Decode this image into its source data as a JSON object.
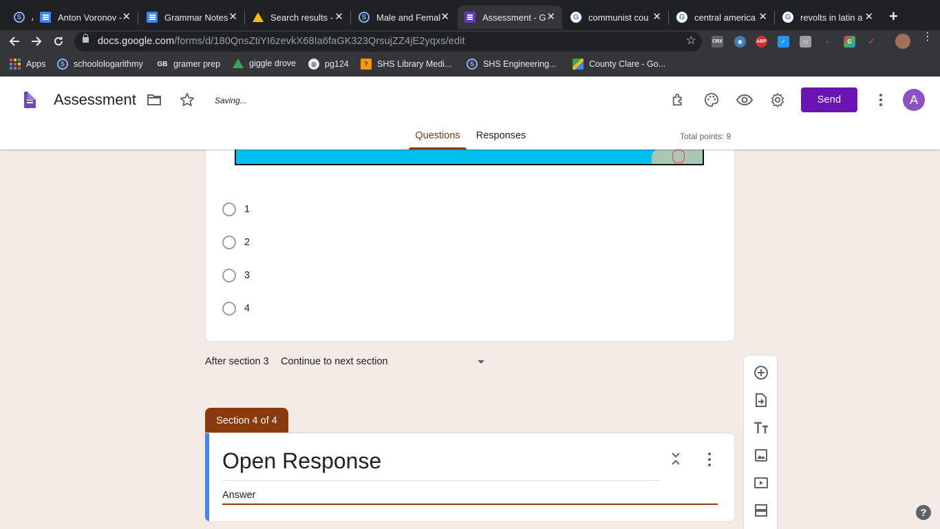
{
  "browser": {
    "tabs": [
      {
        "title": "Anton Voronov -",
        "icon": "schoology-icon"
      },
      {
        "title": "Grammar Notes",
        "icon": "google-docs-icon"
      },
      {
        "title": "Search results -",
        "icon": "google-drive-icon"
      },
      {
        "title": "Male and Femal",
        "icon": "schoology-icon"
      },
      {
        "title": "Assessment - G",
        "icon": "google-forms-icon",
        "active": true
      },
      {
        "title": "communist cou",
        "icon": "google-icon"
      },
      {
        "title": "central america",
        "icon": "google-icon"
      },
      {
        "title": "revolts in latin a",
        "icon": "google-icon"
      }
    ],
    "url_host": "docs.google.com",
    "url_path": "/forms/d/180QnsZtiYI6zevkX68Ia6faGK323QrsujZZ4jE2yqxs/edit",
    "extensions": [
      "CRX",
      "ABP"
    ],
    "bookmarks": [
      {
        "label": "Apps",
        "icon": "apps-grid-icon"
      },
      {
        "label": "schoolologarithmy",
        "icon": "schoology-icon"
      },
      {
        "label": "gramer prep",
        "icon": "gb-icon"
      },
      {
        "label": "giggle drove",
        "icon": "google-drive-icon"
      },
      {
        "label": "pg124",
        "icon": "globe-icon"
      },
      {
        "label": "SHS Library Medi...",
        "icon": "library-icon"
      },
      {
        "label": "SHS Engineering...",
        "icon": "schoology-icon"
      },
      {
        "label": "County Clare - Go...",
        "icon": "maps-icon"
      }
    ]
  },
  "form": {
    "title": "Assessment",
    "status": "Saving...",
    "send_label": "Send",
    "avatar_letter": "A",
    "tabs": {
      "questions": "Questions",
      "responses": "Responses"
    },
    "total_points": "Total points: 9",
    "options": [
      "1",
      "2",
      "3",
      "4"
    ],
    "after_section_label": "After section 3",
    "after_section_value": "Continue to next section",
    "section": {
      "tab_label": "Section 4 of 4",
      "title": "Open Response",
      "answer_label": "Answer"
    }
  },
  "colors": {
    "accent": "#8b3a0e",
    "send": "#6b14b4",
    "background": "#f4ebe6",
    "section_bar": "#4285f4"
  }
}
